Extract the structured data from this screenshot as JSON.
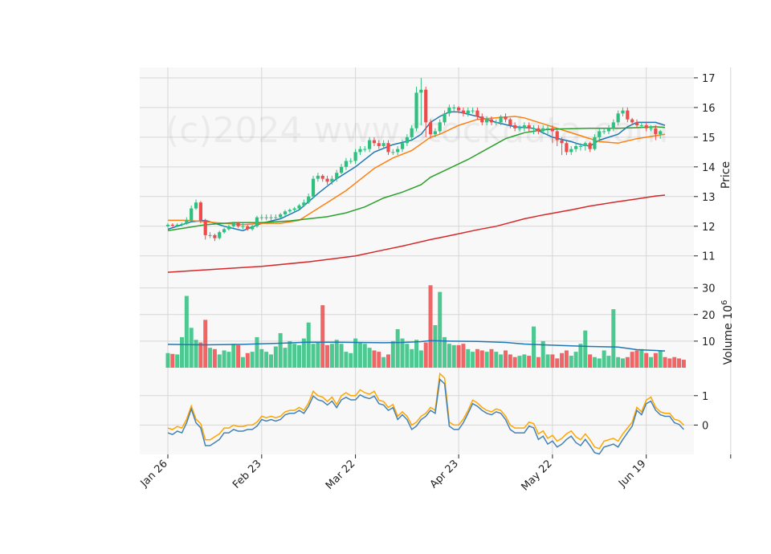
{
  "chart_data": {
    "type": "candlestick",
    "watermark": "(c)2024 www.stockdata.com",
    "colors": {
      "up": "#2fbf7f",
      "down": "#ee4b4b",
      "ma_short": "#1f77b4",
      "ma_mid": "#ff7f0e",
      "ma_long": "#2ca02c",
      "ma_longest": "#d62728",
      "osc_fast": "#ffa500",
      "osc_slow": "#4682b4",
      "panel_bg": "#f8f8f8",
      "grid": "#d6d6d6"
    },
    "x_tick_labels": [
      "Jan 26",
      "Feb 23",
      "Mar 22",
      "Apr 23",
      "May 22",
      "Jun 19"
    ],
    "price_axis": {
      "label": "Price",
      "ticks": [
        "11",
        "12",
        "13",
        "14",
        "15",
        "16",
        "17"
      ],
      "ylim": [
        10.1,
        17.35
      ]
    },
    "volume_axis": {
      "label": "Volume",
      "multiplier": "10",
      "exponent": "6",
      "ticks": [
        "10",
        "20",
        "30"
      ],
      "ylim": [
        0,
        32
      ]
    },
    "osc_axis": {
      "ticks": [
        "0",
        "1"
      ],
      "ylim": [
        -1.0,
        1.95
      ]
    },
    "candles": {
      "open": [
        12.0,
        12.05,
        12.02,
        12.05,
        12.08,
        12.2,
        12.6,
        12.8,
        12.2,
        11.7,
        11.7,
        11.6,
        11.8,
        11.9,
        12.0,
        12.1,
        12.0,
        12.0,
        11.9,
        12.0,
        12.3,
        12.3,
        12.3,
        12.3,
        12.3,
        12.4,
        12.5,
        12.55,
        12.6,
        12.7,
        12.8,
        13.0,
        13.6,
        13.7,
        13.6,
        13.5,
        13.6,
        13.8,
        14.0,
        14.2,
        14.2,
        14.5,
        14.6,
        14.6,
        14.9,
        14.8,
        14.7,
        14.8,
        14.5,
        14.5,
        14.6,
        14.8,
        15.0,
        15.3,
        16.5,
        16.6,
        15.5,
        15.1,
        15.2,
        15.5,
        15.8,
        16.0,
        16.0,
        15.9,
        15.8,
        15.9,
        15.9,
        15.7,
        15.5,
        15.6,
        15.5,
        15.5,
        15.7,
        15.6,
        15.4,
        15.3,
        15.3,
        15.4,
        15.3,
        15.3,
        15.2,
        15.3,
        15.3,
        15.2,
        14.9,
        14.8,
        14.5,
        14.6,
        14.7,
        14.7,
        14.8,
        14.6,
        15.0,
        15.2,
        15.2,
        15.3,
        15.5,
        15.8,
        15.9,
        15.6,
        15.5,
        15.4,
        15.4,
        15.3,
        15.3,
        15.1
      ],
      "close": [
        12.05,
        12.02,
        12.05,
        12.08,
        12.2,
        12.6,
        12.8,
        12.2,
        11.7,
        11.7,
        11.6,
        11.8,
        11.9,
        12.0,
        12.1,
        12.0,
        12.0,
        11.9,
        12.0,
        12.3,
        12.3,
        12.3,
        12.3,
        12.3,
        12.4,
        12.5,
        12.55,
        12.6,
        12.7,
        12.8,
        13.0,
        13.6,
        13.7,
        13.6,
        13.5,
        13.6,
        13.8,
        14.0,
        14.2,
        14.2,
        14.5,
        14.6,
        14.6,
        14.9,
        14.8,
        14.7,
        14.8,
        14.5,
        14.5,
        14.6,
        14.8,
        15.0,
        15.3,
        16.5,
        16.6,
        15.5,
        15.1,
        15.2,
        15.5,
        15.8,
        16.0,
        16.0,
        15.9,
        15.8,
        15.9,
        15.9,
        15.7,
        15.5,
        15.6,
        15.5,
        15.5,
        15.7,
        15.6,
        15.4,
        15.3,
        15.3,
        15.4,
        15.3,
        15.3,
        15.2,
        15.3,
        15.3,
        15.2,
        14.9,
        14.8,
        14.5,
        14.6,
        14.7,
        14.7,
        14.8,
        14.6,
        15.0,
        15.2,
        15.2,
        15.3,
        15.5,
        15.8,
        15.9,
        15.6,
        15.5,
        15.4,
        15.4,
        15.3,
        15.3,
        15.1,
        15.2
      ],
      "high": [
        12.1,
        12.1,
        12.1,
        12.12,
        12.3,
        12.7,
        12.9,
        12.85,
        12.25,
        11.8,
        11.75,
        11.85,
        11.95,
        12.05,
        12.15,
        12.15,
        12.1,
        12.05,
        12.05,
        12.35,
        12.4,
        12.4,
        12.4,
        12.4,
        12.45,
        12.55,
        12.6,
        12.65,
        12.75,
        12.9,
        13.1,
        13.7,
        13.8,
        13.75,
        13.7,
        13.7,
        13.9,
        14.1,
        14.3,
        14.3,
        14.6,
        14.7,
        14.7,
        15.0,
        15.0,
        14.9,
        14.9,
        14.9,
        14.6,
        14.7,
        14.9,
        15.1,
        15.4,
        16.7,
        17.0,
        16.7,
        15.6,
        15.3,
        15.6,
        15.9,
        16.1,
        16.1,
        16.05,
        16.0,
        16.0,
        16.0,
        16.0,
        15.8,
        15.7,
        15.7,
        15.6,
        15.75,
        15.8,
        15.65,
        15.5,
        15.4,
        15.5,
        15.5,
        15.4,
        15.4,
        15.4,
        15.4,
        15.4,
        15.25,
        15.0,
        14.9,
        14.7,
        14.8,
        14.8,
        14.85,
        14.85,
        15.1,
        15.3,
        15.3,
        15.4,
        15.6,
        15.9,
        16.0,
        16.0,
        15.65,
        15.6,
        15.5,
        15.5,
        15.4,
        15.4,
        15.25
      ],
      "low": [
        11.95,
        11.98,
        11.98,
        12.0,
        12.05,
        12.15,
        12.55,
        12.1,
        11.55,
        11.6,
        11.5,
        11.55,
        11.75,
        11.85,
        11.95,
        11.95,
        11.9,
        11.85,
        11.85,
        11.95,
        12.2,
        12.2,
        12.2,
        12.2,
        12.25,
        12.35,
        12.45,
        12.5,
        12.55,
        12.65,
        12.75,
        12.95,
        13.5,
        13.5,
        13.4,
        13.4,
        13.5,
        13.75,
        13.9,
        14.1,
        14.1,
        14.4,
        14.5,
        14.5,
        14.7,
        14.6,
        14.6,
        14.4,
        14.4,
        14.4,
        14.5,
        14.7,
        14.9,
        15.2,
        15.4,
        15.0,
        14.95,
        15.0,
        15.1,
        15.4,
        15.7,
        15.85,
        15.8,
        15.7,
        15.7,
        15.8,
        15.6,
        15.4,
        15.4,
        15.4,
        15.4,
        15.4,
        15.5,
        15.3,
        15.2,
        15.2,
        15.2,
        15.2,
        15.1,
        15.1,
        15.1,
        15.1,
        14.8,
        14.7,
        14.4,
        14.4,
        14.4,
        14.5,
        14.55,
        14.55,
        14.5,
        14.55,
        14.9,
        15.1,
        15.1,
        15.2,
        15.4,
        15.7,
        15.5,
        15.4,
        15.3,
        15.3,
        15.2,
        15.2,
        14.9,
        14.95
      ],
      "volume": [
        5.5,
        5.2,
        5.0,
        11.5,
        27.0,
        15.0,
        10.5,
        9.5,
        18.0,
        7.5,
        7.0,
        5.0,
        6.5,
        6.0,
        9.0,
        8.5,
        4.0,
        5.5,
        6.0,
        11.5,
        7.0,
        6.0,
        5.0,
        8.0,
        13.0,
        7.5,
        10.0,
        9.0,
        8.5,
        11.0,
        17.0,
        9.0,
        9.5,
        23.5,
        8.5,
        9.0,
        10.5,
        9.0,
        6.0,
        5.5,
        11.0,
        9.5,
        9.0,
        7.5,
        6.5,
        6.0,
        4.0,
        5.0,
        10.0,
        14.5,
        11.0,
        9.0,
        7.0,
        10.5,
        6.5,
        9.5,
        31.0,
        16.0,
        28.5,
        11.5,
        9.0,
        8.5,
        8.5,
        9.0,
        7.0,
        6.0,
        7.0,
        6.5,
        6.0,
        7.0,
        6.0,
        5.0,
        6.5,
        5.0,
        4.0,
        4.5,
        5.0,
        4.5,
        15.5,
        4.0,
        10.0,
        5.0,
        5.0,
        3.5,
        5.5,
        6.5,
        4.5,
        6.0,
        9.0,
        14.0,
        5.0,
        4.0,
        3.5,
        6.5,
        4.5,
        22.0,
        4.0,
        3.5,
        4.0,
        6.0,
        6.5,
        7.0,
        5.5,
        4.0,
        5.5,
        6.5,
        4.0,
        3.5,
        4.0,
        3.5,
        3.0
      ]
    },
    "price_lines": [
      {
        "color": "ma_short",
        "points": [
          [
            0,
            11.9
          ],
          [
            5,
            12.15
          ],
          [
            8,
            12.2
          ],
          [
            12,
            12.0
          ],
          [
            16,
            11.85
          ],
          [
            20,
            12.1
          ],
          [
            24,
            12.25
          ],
          [
            28,
            12.55
          ],
          [
            32,
            13.1
          ],
          [
            36,
            13.6
          ],
          [
            40,
            14.0
          ],
          [
            44,
            14.5
          ],
          [
            48,
            14.75
          ],
          [
            52,
            14.9
          ],
          [
            54,
            15.1
          ],
          [
            56,
            15.5
          ],
          [
            58,
            15.7
          ],
          [
            60,
            15.85
          ],
          [
            62,
            15.85
          ],
          [
            66,
            15.7
          ],
          [
            70,
            15.5
          ],
          [
            74,
            15.35
          ],
          [
            78,
            15.3
          ],
          [
            82,
            15.0
          ],
          [
            86,
            14.85
          ],
          [
            88,
            14.75
          ],
          [
            90,
            14.7
          ],
          [
            92,
            14.9
          ],
          [
            94,
            15.0
          ],
          [
            96,
            15.1
          ],
          [
            98,
            15.35
          ],
          [
            100,
            15.5
          ],
          [
            104,
            15.5
          ],
          [
            106,
            15.4
          ]
        ]
      },
      {
        "color": "ma_mid",
        "points": [
          [
            0,
            12.2
          ],
          [
            4,
            12.2
          ],
          [
            8,
            12.15
          ],
          [
            12,
            12.1
          ],
          [
            16,
            12.05
          ],
          [
            20,
            12.1
          ],
          [
            24,
            12.1
          ],
          [
            28,
            12.2
          ],
          [
            30,
            12.4
          ],
          [
            34,
            12.8
          ],
          [
            38,
            13.2
          ],
          [
            40,
            13.45
          ],
          [
            44,
            13.95
          ],
          [
            48,
            14.3
          ],
          [
            52,
            14.55
          ],
          [
            56,
            15.0
          ],
          [
            58,
            15.1
          ],
          [
            62,
            15.4
          ],
          [
            66,
            15.6
          ],
          [
            70,
            15.65
          ],
          [
            74,
            15.7
          ],
          [
            76,
            15.65
          ],
          [
            80,
            15.45
          ],
          [
            84,
            15.25
          ],
          [
            88,
            15.05
          ],
          [
            92,
            14.85
          ],
          [
            96,
            14.8
          ],
          [
            100,
            14.95
          ],
          [
            104,
            15.05
          ],
          [
            106,
            15.1
          ]
        ]
      },
      {
        "color": "ma_long",
        "points": [
          [
            0,
            11.85
          ],
          [
            4,
            11.95
          ],
          [
            8,
            12.05
          ],
          [
            14,
            12.12
          ],
          [
            20,
            12.12
          ],
          [
            26,
            12.18
          ],
          [
            30,
            12.25
          ],
          [
            34,
            12.32
          ],
          [
            38,
            12.45
          ],
          [
            42,
            12.65
          ],
          [
            46,
            12.95
          ],
          [
            50,
            13.15
          ],
          [
            54,
            13.4
          ],
          [
            56,
            13.65
          ],
          [
            60,
            13.95
          ],
          [
            64,
            14.25
          ],
          [
            68,
            14.6
          ],
          [
            72,
            14.95
          ],
          [
            74,
            15.05
          ],
          [
            76,
            15.15
          ],
          [
            80,
            15.25
          ],
          [
            84,
            15.28
          ],
          [
            90,
            15.3
          ],
          [
            96,
            15.3
          ],
          [
            100,
            15.32
          ],
          [
            104,
            15.35
          ],
          [
            106,
            15.33
          ]
        ]
      },
      {
        "color": "ma_longest",
        "points": [
          [
            0,
            10.45
          ],
          [
            10,
            10.55
          ],
          [
            20,
            10.65
          ],
          [
            30,
            10.8
          ],
          [
            36,
            10.92
          ],
          [
            40,
            11.0
          ],
          [
            46,
            11.2
          ],
          [
            50,
            11.33
          ],
          [
            56,
            11.55
          ],
          [
            60,
            11.68
          ],
          [
            66,
            11.88
          ],
          [
            70,
            12.0
          ],
          [
            76,
            12.25
          ],
          [
            80,
            12.38
          ],
          [
            86,
            12.55
          ],
          [
            90,
            12.68
          ],
          [
            96,
            12.83
          ],
          [
            100,
            12.92
          ],
          [
            104,
            13.02
          ],
          [
            106,
            13.05
          ]
        ]
      }
    ],
    "volume_line": [
      [
        0,
        8.8
      ],
      [
        8,
        8.6
      ],
      [
        16,
        8.8
      ],
      [
        24,
        9.2
      ],
      [
        30,
        9.6
      ],
      [
        36,
        9.6
      ],
      [
        46,
        9.4
      ],
      [
        50,
        9.5
      ],
      [
        54,
        9.8
      ],
      [
        56,
        10.2
      ],
      [
        60,
        10.0
      ],
      [
        66,
        9.9
      ],
      [
        72,
        9.5
      ],
      [
        76,
        8.9
      ],
      [
        80,
        8.6
      ],
      [
        86,
        8.2
      ],
      [
        90,
        8.0
      ],
      [
        96,
        7.8
      ],
      [
        100,
        6.8
      ],
      [
        104,
        6.5
      ],
      [
        106,
        6.3
      ]
    ],
    "osc_fast": [
      -0.1,
      -0.15,
      -0.05,
      -0.1,
      0.2,
      0.65,
      0.2,
      0.05,
      -0.5,
      -0.5,
      -0.4,
      -0.3,
      -0.1,
      -0.1,
      0.0,
      -0.05,
      -0.05,
      0.0,
      0.0,
      0.1,
      0.3,
      0.25,
      0.3,
      0.25,
      0.3,
      0.45,
      0.5,
      0.5,
      0.6,
      0.5,
      0.75,
      1.15,
      1.0,
      0.95,
      0.8,
      0.95,
      0.7,
      1.0,
      1.1,
      1.0,
      1.0,
      1.2,
      1.1,
      1.05,
      1.15,
      0.85,
      0.8,
      0.6,
      0.7,
      0.3,
      0.45,
      0.3,
      0.0,
      0.1,
      0.3,
      0.4,
      0.6,
      0.5,
      1.75,
      1.6,
      0.1,
      0.0,
      0.0,
      0.2,
      0.5,
      0.85,
      0.75,
      0.6,
      0.5,
      0.45,
      0.55,
      0.5,
      0.3,
      0.0,
      -0.1,
      -0.1,
      -0.1,
      0.1,
      0.05,
      -0.3,
      -0.2,
      -0.45,
      -0.35,
      -0.55,
      -0.45,
      -0.3,
      -0.2,
      -0.4,
      -0.5,
      -0.3,
      -0.5,
      -0.75,
      -0.8,
      -0.55,
      -0.5,
      -0.45,
      -0.55,
      -0.3,
      -0.1,
      0.1,
      0.6,
      0.45,
      0.85,
      0.95,
      0.6,
      0.45,
      0.4,
      0.4,
      0.2,
      0.15,
      0.0
    ]
  }
}
